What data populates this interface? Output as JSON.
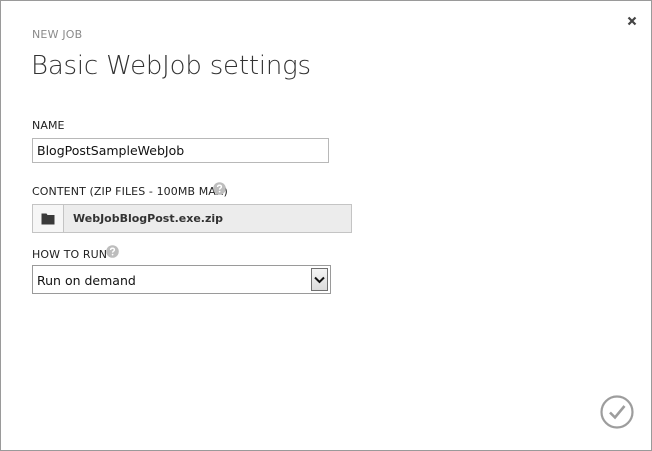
{
  "dialog": {
    "overline": "NEW JOB",
    "title": "Basic WebJob settings"
  },
  "fields": {
    "name": {
      "label": "NAME",
      "value": "BlogPostSampleWebJob"
    },
    "content": {
      "label": "CONTENT (ZIP FILES - 100MB MAX)",
      "file_name": "WebJobBlogPost.exe.zip"
    },
    "how_to_run": {
      "label": "HOW TO RUN",
      "selected": "Run on demand"
    }
  },
  "icons": {
    "close": "close-icon",
    "help": "question-circle-icon",
    "folder": "folder-icon",
    "select_arrow": "chevron-down-icon",
    "confirm": "checkmark-circle-icon"
  },
  "colors": {
    "title_text": "#333333",
    "muted_text": "#8a8a8a",
    "help_icon": "#bdbdbd",
    "confirm_icon": "#9d9d9d",
    "file_picker_bg": "#ececec"
  }
}
